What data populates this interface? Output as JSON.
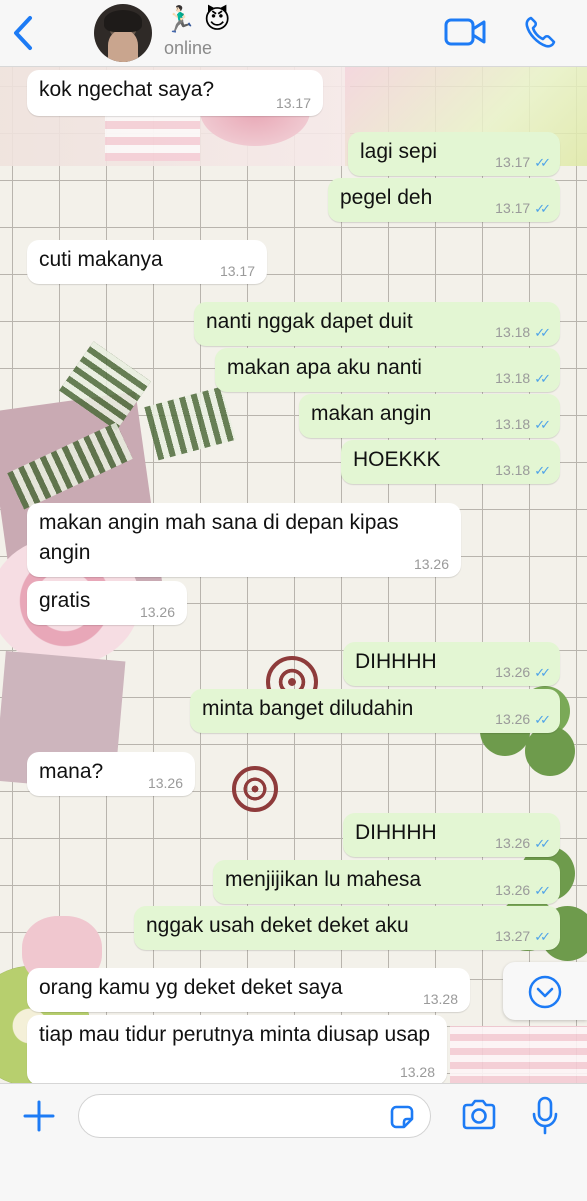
{
  "header": {
    "back_icon": "chevron-left-icon",
    "contact_emoji": "🏃🏻‍♂️ 😈",
    "status": "online",
    "video_icon": "video-camera-icon",
    "call_icon": "phone-icon"
  },
  "messages": [
    {
      "dir": "in",
      "text": "kok ngechat saya?",
      "time": "13.17"
    },
    {
      "dir": "out",
      "text": "lagi sepi",
      "time": "13.17"
    },
    {
      "dir": "out",
      "text": "pegel deh",
      "time": "13.17"
    },
    {
      "dir": "in",
      "text": "cuti makanya",
      "time": "13.17"
    },
    {
      "dir": "out",
      "text": "nanti nggak dapet duit",
      "time": "13.18"
    },
    {
      "dir": "out",
      "text": "makan apa aku nanti",
      "time": "13.18"
    },
    {
      "dir": "out",
      "text": "makan angin",
      "time": "13.18"
    },
    {
      "dir": "out",
      "text": "HOEKKK",
      "time": "13.18"
    },
    {
      "dir": "in",
      "text": "makan angin mah sana di depan kipas angin",
      "time": "13.26"
    },
    {
      "dir": "in",
      "text": "gratis",
      "time": "13.26"
    },
    {
      "dir": "out",
      "text": "DIHHHH",
      "time": "13.26"
    },
    {
      "dir": "out",
      "text": "minta banget diludahin",
      "time": "13.26"
    },
    {
      "dir": "in",
      "text": "mana?",
      "time": "13.26"
    },
    {
      "dir": "out",
      "text": "DIHHHH",
      "time": "13.26"
    },
    {
      "dir": "out",
      "text": "menjijikan lu mahesa",
      "time": "13.26"
    },
    {
      "dir": "out",
      "text": "nggak usah deket deket aku",
      "time": "13.27"
    },
    {
      "dir": "in",
      "text": "orang kamu yg deket deket saya",
      "time": "13.28"
    },
    {
      "dir": "in",
      "text": "tiap mau tidur perutnya minta diusap usap",
      "time": "13.28"
    }
  ],
  "read_ticks": "✓✓",
  "scroll_down_icon": "chevron-down-circle-icon",
  "footer": {
    "plus_icon": "plus-icon",
    "input_value": "",
    "sticker_icon": "sticker-icon",
    "camera_icon": "camera-icon",
    "mic_icon": "microphone-icon"
  },
  "colors": {
    "accent": "#1d7bf5",
    "outgoing_bubble": "#e3f6d3",
    "incoming_bubble": "#ffffff",
    "read_ticks": "#4fa3e8"
  }
}
